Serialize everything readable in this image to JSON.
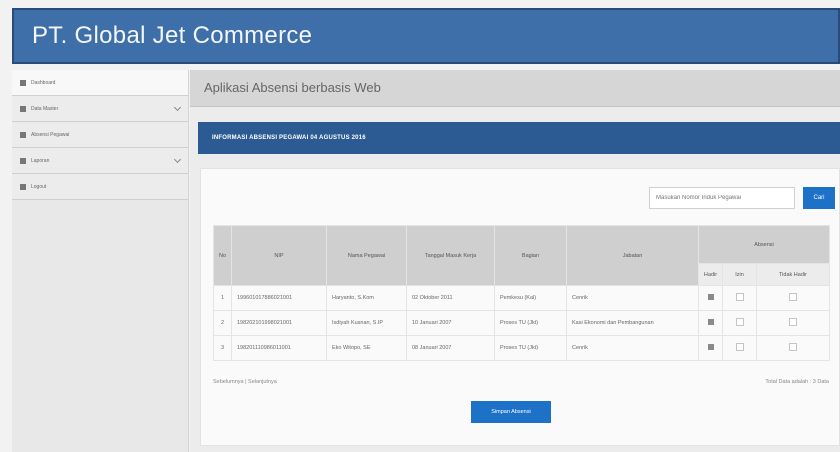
{
  "header": {
    "title": "PT. Global Jet Commerce"
  },
  "sidebar": {
    "items": [
      {
        "label": "Dashboard",
        "icon": "home-icon",
        "has_submenu": false,
        "active": true
      },
      {
        "label": "Data Master",
        "icon": "list-icon",
        "has_submenu": true,
        "active": false
      },
      {
        "label": "Absensi Pegawai",
        "icon": "pencil-icon",
        "has_submenu": false,
        "active": false
      },
      {
        "label": "Laporan",
        "icon": "document-icon",
        "has_submenu": true,
        "active": false
      },
      {
        "label": "Logout",
        "icon": "logout-icon",
        "has_submenu": false,
        "active": false
      }
    ]
  },
  "main": {
    "app_title": "Aplikasi Absensi berbasis Web",
    "panel_title": "INFORMASI ABSENSI PEGAWAI 04 AGUSTUS 2016",
    "search": {
      "placeholder": "Masukan Nomor Induk Pegawai",
      "button_label": "Cari"
    },
    "table": {
      "columns": [
        "No",
        "NIP",
        "Nama Pegawai",
        "Tanggal Masuk Kerja",
        "Bagian",
        "Jabatan",
        "Absensi"
      ],
      "sub_columns": [
        "Hadir",
        "Izin",
        "Tidak Hadir"
      ],
      "rows": [
        {
          "no": "1",
          "nip": "199601017886021001",
          "nama": "Haryanto, S.Kom",
          "tanggal": "02 Oktober 2011",
          "bagian": "Pemkesu (Kal)",
          "jabatan": "Cenrik"
        },
        {
          "no": "2",
          "nip": "198202101998021001",
          "nama": "Isdiyah Kusnan, S.IP",
          "tanggal": "10 Januari 2007",
          "bagian": "Proses TU (Jkt)",
          "jabatan": "Kasi Ekonomi dan Pembangunan"
        },
        {
          "no": "3",
          "nip": "198201110986011001",
          "nama": "Eko Witopo, SE",
          "tanggal": "08 Januari 2007",
          "bagian": "Proses TU (Jkt)",
          "jabatan": "Cenrik"
        }
      ]
    },
    "footer_left": "Sebelumnya | Selanjutnya",
    "footer_right": "Total Data adalah : 3 Data",
    "save_button": "Simpan Absensi"
  },
  "colors": {
    "header": "#3e6fa9",
    "panel_head": "#2b5b92",
    "button": "#1d72c8"
  }
}
